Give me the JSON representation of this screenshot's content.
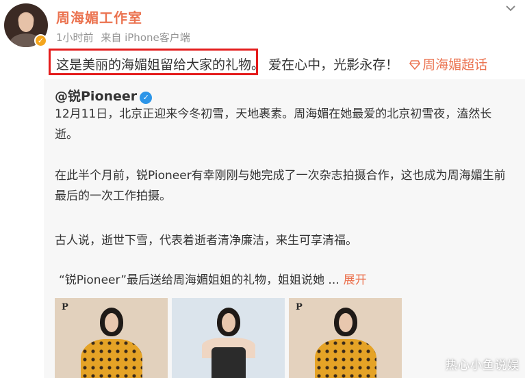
{
  "post": {
    "username": "周海媚工作室",
    "time": "1小时前",
    "source": "来自 iPhone客户端",
    "text_highlighted": "这是美丽的海媚姐留给大家的礼物。",
    "text_rest": "爱在心中，光影永存！",
    "supertopic": "周海媚超话"
  },
  "repost": {
    "author": "@锐Pioneer",
    "paragraphs": [
      "12月11日，北京正迎来今冬初雪，天地裹素。周海媚在她最爱的北京初雪夜，溘然长逝。",
      "在此半个月前，锐Pioneer有幸刚刚与她完成了一次杂志拍摄合作，这也成为周海媚生前最后的一次工作拍摄。",
      "古人说，逝世下雪，代表着逝者清净廉洁，来生可享清福。",
      "“锐Pioneer”最后送给周海媚姐姐的礼物，姐姐说她 ..."
    ],
    "expand_label": "展开",
    "thumb_logo": "P"
  },
  "watermark": "热心小鱼说娱",
  "colors": {
    "accent": "#eb7350",
    "highlight_border": "#e41c1c",
    "repost_bg": "#f7f7f7",
    "verified_blue": "#2c95e8"
  },
  "icons": {
    "chevron": "chevron-down-icon",
    "supertopic": "diamond-icon",
    "verified": "verified-badge-icon"
  }
}
